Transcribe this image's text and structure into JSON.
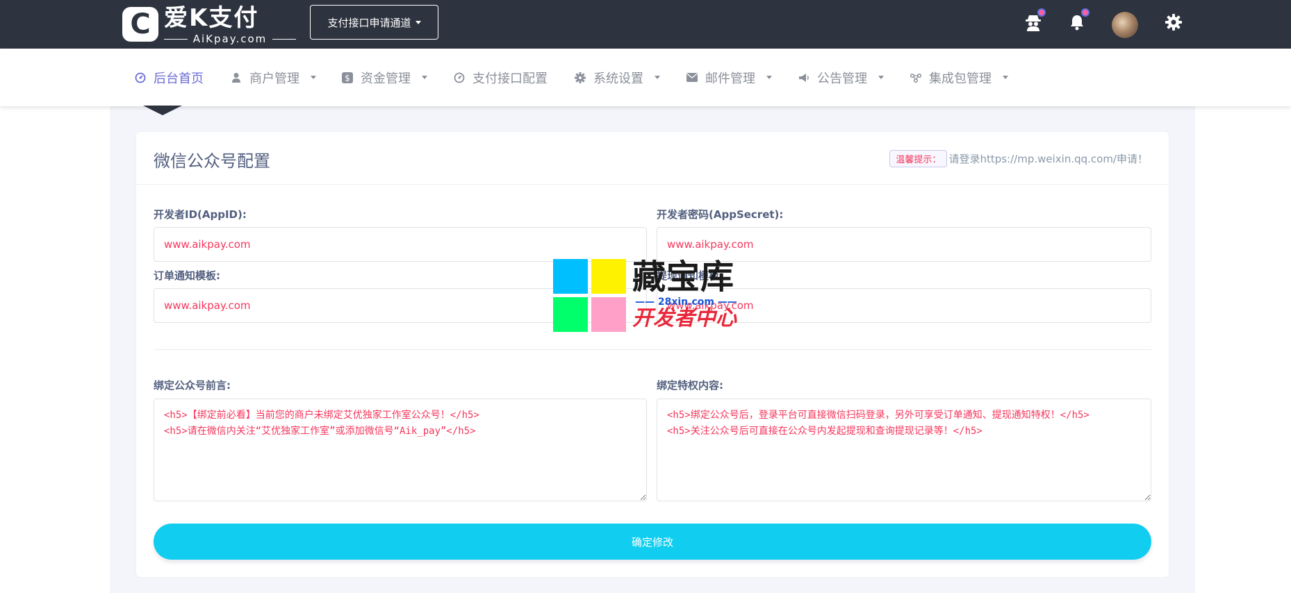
{
  "brand": {
    "logo_mark": "C",
    "title": "爱K支付",
    "subtitle": "AiKpay.com"
  },
  "topbar": {
    "apply_button": "支付接口申请通道",
    "icons": [
      "spy-icon",
      "bell-icon",
      "avatar",
      "gear-icon"
    ],
    "badge_color": "#ff5ea0"
  },
  "nav": {
    "items": [
      {
        "label": "后台首页",
        "icon": "dashboard-icon",
        "active": true,
        "dropdown": false
      },
      {
        "label": "商户管理",
        "icon": "user-icon",
        "active": false,
        "dropdown": true
      },
      {
        "label": "资金管理",
        "icon": "dollar-icon",
        "active": false,
        "dropdown": true
      },
      {
        "label": "支付接口配置",
        "icon": "dashboard-icon",
        "active": false,
        "dropdown": false
      },
      {
        "label": "系统设置",
        "icon": "gear-icon",
        "active": false,
        "dropdown": true
      },
      {
        "label": "邮件管理",
        "icon": "envelope-icon",
        "active": false,
        "dropdown": true
      },
      {
        "label": "公告管理",
        "icon": "megaphone-icon",
        "active": false,
        "dropdown": true
      },
      {
        "label": "集成包管理",
        "icon": "molecule-icon",
        "active": false,
        "dropdown": true
      }
    ]
  },
  "card": {
    "title": "微信公众号配置",
    "hint_badge": "温馨提示：",
    "hint_text": "请登录https://mp.weixin.qq.com/申请！"
  },
  "form": {
    "app_id": {
      "label": "开发者ID(AppID):",
      "value": "www.aikpay.com"
    },
    "app_secret": {
      "label": "开发者密码(AppSecret):",
      "value": "www.aikpay.com"
    },
    "order_template": {
      "label": "订单通知模板:",
      "value": "www.aikpay.com"
    },
    "withdraw_template": {
      "label": "提现通知模板:",
      "value": "www.aikpay.com"
    },
    "bind_preface": {
      "label": "绑定公众号前言:",
      "value": "<h5>【绑定前必看】当前您的商户未绑定艾优独家工作室公众号！</h5>\n<h5>请在微信内关注“艾优独家工作室”或添加微信号“Aik_pay”</h5>"
    },
    "bind_privilege": {
      "label": "绑定特权内容:",
      "value": "<h5>绑定公众号后，登录平台可直接微信扫码登录，另外可享受订单通知、提现通知特权！</h5>\n<h5>关注公众号后可直接在公众号内发起提现和查询提现记录等！</h5>"
    },
    "submit": "确定修改"
  },
  "watermark": {
    "title": "藏宝库",
    "url": "—— 28xin.com ——",
    "subtitle": "开发者中心",
    "colors": [
      "#00bfff",
      "#fff200",
      "#00ff6a",
      "#ffa0c8"
    ]
  },
  "colors": {
    "topbar": "#2d333f",
    "accent": "#11cdef",
    "active_nav": "#6b6bd6",
    "value_text": "#f5365c"
  }
}
